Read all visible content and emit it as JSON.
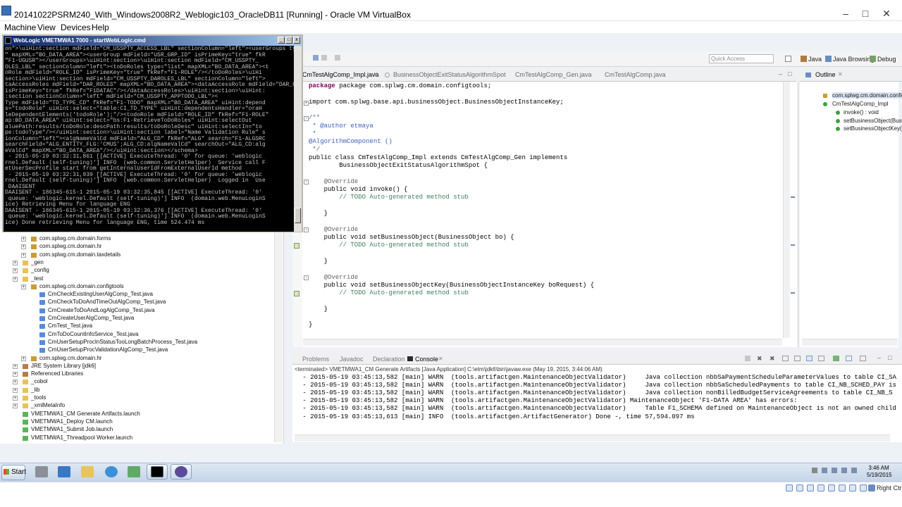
{
  "vbox": {
    "title": "20141022PSRM240_With_Windows2008R2_Weblogic103_OracleDB11 [Running] - Oracle VM VirtualBox",
    "menus": [
      "Machine",
      "View",
      "Devices",
      "Help"
    ],
    "host_key": "Right Ctr"
  },
  "cmd": {
    "title": "WebLogic VMETMWA1 7000 - startWebLogic.cmd",
    "lines": [
      "on\">\\uiHint:section mdField=\"CM_USSPTY_ACCESS_LBL\" sectionColumn=\"left\"><userGroups type=\"l",
      "\" mapXML=\"BO_DATA_AREA\"><userGroup mdField=\"USR_GRP_ID\" isPrimeKey=\"true\" fkR",
      "\"F1-UGUSR\"></userGroups>\\uiHint:section>\\uiHint:section mdField=\"CM_USSPTY_",
      "OLES_LBL\" sectionColumn=\"left\"><toDoRoles type=\"list\" mapXML=\"BO_DATA_AREA\"><t",
      "oRole mdField=\"ROLE_ID\" isPrimeKey=\"true\" fkRef=\"F1-ROLE\"/></toDoRoles>\\uiHi",
      "section>\\uiHint:section mdField=\"CM_USSPTY_DAROLES_LBL\" sectionColumn=\"left\">",
      "taAccessRoles mdField=\"DAR_ROLES\" mapXML=\"BO_DATA_AREA\"><dataAccessRole mdField=\"DAR_C",
      "isPrimeKey=\"true\" fkRef=\"F1DATAC\"/></dataAccessRoles>\\uiHint:section>\\uiHint:",
      ":section sectionColumn=\"left\" mdField=\"CM_USSPTY_APPTODO_LBL\"><",
      "Type mdField=\"TD_TYPE_CD\" fkRef=\"F1-TODO\" mapXML=\"BO_DATA_AREA\" uiHint:depend",
      "s=\"todoRole\" uiHint:select=\"table:CI_TD_TYPE\" uiHint:dependentsHandler=\"oraH",
      "leDependentElements('todoRole');\"/><todoRole mdField=\"ROLE_ID\" fkRef=\"F1-ROLE\"",
      "ap:BO_DATA_AREA\" uiHint:select=\"bs:F1-RetrieveToDoRoles\" uiHint:selectOut",
      "aluePath:results/toDoRole:descPath:results/toDoRoleDesc\" uiHint:selectIn=\"to",
      "pe:todoType\"/></uiHint:section>\\uiHint:section label=\"Name Validation Rule\" s",
      "ionColumn=\"left\"><algNameValCd mdField=\"ALG_CD\" fkRef=\"ALG\" search=\"F1-ALGSRC",
      "searchField=\"ALG_ENTITY_FLG:'CMUS';ALG_CD:algNameValCd\" searchOut=\"ALG_CD:alg",
      "eValCd\" mapXML=\"BO_DATA_AREA\"/></uiHint:section></schema>",
      " - 2015-05-19 03:32:31,861 [[ACTIVE] ExecuteThread: '0' for queue: 'weblogic",
      "rnel.Default (self-tuning)'] INFO  (web.common.ServletHelper)  Service call F",
      "etUserSecProfile start from getInternalUserIdFromExternalUserId method",
      " - 2015-05-19 03:32:31,939 [[ACTIVE] ExecuteThread: '0' for queue: 'weblogic",
      "rnel.Default (self-tuning)'] INFO  (web.common.ServletHelper)  Logged in  Use",
      " DAAISENT",
      "DAAISENT - 186345-615-1 2015-05-19 03:32:35,845 [[ACTIVE] ExecuteThread: '0'",
      " queue: 'weblogic.kernel.Default (self-tuning)'] INFO  (domain.web.MenuLoginS",
      "ice) Retrieving Menu for language ENG",
      "DAAISENT - 186345-615-1 2015-05-19 03:32:36,376 [[ACTIVE] ExecuteThread: '0'",
      " queue: 'weblogic.kernel.Default (self-tuning)'] INFO  (domain.web.MenuLoginS",
      "ice) Done retrieving Menu for language ENG, time 524.474 ms"
    ]
  },
  "eclipse": {
    "quick_access": "Quick Access",
    "perspectives": [
      "Java",
      "Java Browsing",
      "Debug"
    ],
    "editor_tabs": [
      "CmTestAlgComp_Impl.java",
      "BusinessObjectExitStatusAlgorithmSpot",
      "CmTestAlgComp_Gen.java",
      "CmTestAlgComp.java"
    ],
    "code": [
      "package com.splwg.cm.domain.configtools;",
      "",
      "import com.splwg.base.api.businessObject.BusinessObjectInstanceKey;",
      "",
      "/**",
      " * @author etmaya",
      " *",
      "@AlgorithmComponent ()",
      " */",
      "public class CmTestAlgComp_Impl extends CmTestAlgComp_Gen implements",
      "        BusinessObjectExitStatusAlgorithmSpot {",
      "",
      "    @Override",
      "    public void invoke() {",
      "        // TODO Auto-generated method stub",
      "",
      "    }",
      "",
      "    @Override",
      "    public void setBusinessObject(BusinessObject bo) {",
      "        // TODO Auto-generated method stub",
      "",
      "    }",
      "",
      "    @Override",
      "    public void setBusinessObjectKey(BusinessObjectInstanceKey boRequest) {",
      "        // TODO Auto-generated method stub",
      "",
      "    }",
      "",
      "}"
    ],
    "outline": {
      "title": "Outline",
      "items": [
        "com.splwg.cm.domain.config",
        "CmTestAlgComp_Impl",
        "invoke() : void",
        "setBusinessObject(Busi",
        "setBusinessObjectKey("
      ]
    },
    "console_tabs": [
      "Problems",
      "Javadoc",
      "Declaration",
      "Console"
    ],
    "console_terminated": "<terminated> VMETMWA1_CM Generate Artifacts [Java Application] C:\\etm\\jdk6\\bin\\javaw.exe (May 19, 2015, 3:44:06 AM)",
    "console_lines": [
      " - 2015-05-19 03:45:13,582 [main] WARN  (tools.artifactgen.MaintenanceObjectValidator)     Java collection nbbSaPaymentScheduleParameterValues to table CI_SA",
      " - 2015-05-19 03:45:13,582 [main] WARN  (tools.artifactgen.MaintenanceObjectValidator)     Java collection nbbSaScheduledPayments to table CI_NB_SCHED_PAY is",
      " - 2015-05-19 03:45:13,582 [main] WARN  (tools.artifactgen.MaintenanceObjectValidator)     Java collection nonBilledBudgetServiceAgreements to table CI_NB_S",
      " - 2015-05-19 03:45:13,582 [main] WARN  (tools.artifactgen.MaintenanceObjectValidator) MaintenanceObject 'F1-DATA AREA' has errors:",
      " - 2015-05-19 03:45:13,582 [main] WARN  (tools.artifactgen.MaintenanceObjectValidator)     Table F1_SCHEMA defined on MaintenanceObject is not an owned child",
      " - 2015-05-19 03:45:13,613 [main] INFO  (tools.artifactgen.ArtifactGenerator) Done -, time 57,594.097 ms"
    ],
    "explorer": [
      {
        "label": "com.splwg.cm.domain.forms",
        "indent": 2,
        "icon": "pkg"
      },
      {
        "label": "com.splwg.cm.domain.hr",
        "indent": 2,
        "icon": "pkg"
      },
      {
        "label": "com.splwg.cm.domain.taxdetails",
        "indent": 2,
        "icon": "pkg"
      },
      {
        "label": "_gen",
        "indent": 1,
        "icon": "folder"
      },
      {
        "label": "_config",
        "indent": 1,
        "icon": "folder"
      },
      {
        "label": "_test",
        "indent": 1,
        "icon": "folder"
      },
      {
        "label": "com.splwg.cm.domain.configtools",
        "indent": 2,
        "icon": "pkg"
      },
      {
        "label": "CmCheckExistingUserAlgComp_Test.java",
        "indent": 3,
        "icon": "java"
      },
      {
        "label": "CmCheckToDoAndTimeOutAlgComp_Test.java",
        "indent": 3,
        "icon": "java"
      },
      {
        "label": "CmCreateToDoAndLogAlgComp_Test.java",
        "indent": 3,
        "icon": "java"
      },
      {
        "label": "CmCreateUserAlgComp_Test.java",
        "indent": 3,
        "icon": "java"
      },
      {
        "label": "CmTest_Test.java",
        "indent": 3,
        "icon": "java"
      },
      {
        "label": "CmToDoCountInfoService_Test.java",
        "indent": 3,
        "icon": "java"
      },
      {
        "label": "CmUserSetupProcInStatusTooLongBatchProcess_Test.java",
        "indent": 3,
        "icon": "java"
      },
      {
        "label": "CmUserSetupProcValidationAlgComp_Test.java",
        "indent": 3,
        "icon": "java"
      },
      {
        "label": "com.splwg.cm.domain.hr",
        "indent": 2,
        "icon": "pkg"
      },
      {
        "label": "JRE System Library [jdk6]",
        "indent": 1,
        "icon": "lib"
      },
      {
        "label": "Referenced Libraries",
        "indent": 1,
        "icon": "lib"
      },
      {
        "label": "_cobol",
        "indent": 1,
        "icon": "folder"
      },
      {
        "label": "_lib",
        "indent": 1,
        "icon": "folder"
      },
      {
        "label": "_tools",
        "indent": 1,
        "icon": "folder"
      },
      {
        "label": "_xmlMetaInfo",
        "indent": 1,
        "icon": "folder"
      },
      {
        "label": "VMETMWA1_CM Generate Artifacts.launch",
        "indent": 1,
        "icon": "launch"
      },
      {
        "label": "VMETMWA1_Deploy CM.launch",
        "indent": 1,
        "icon": "launch"
      },
      {
        "label": "VMETMWA1_Submit Job.launch",
        "indent": 1,
        "icon": "launch"
      },
      {
        "label": "VMETMWA1_Threadpool Worker.launch",
        "indent": 1,
        "icon": "launch"
      }
    ]
  },
  "taskbar": {
    "start": "Start",
    "time": "3:46 AM",
    "date": "5/19/2015"
  }
}
